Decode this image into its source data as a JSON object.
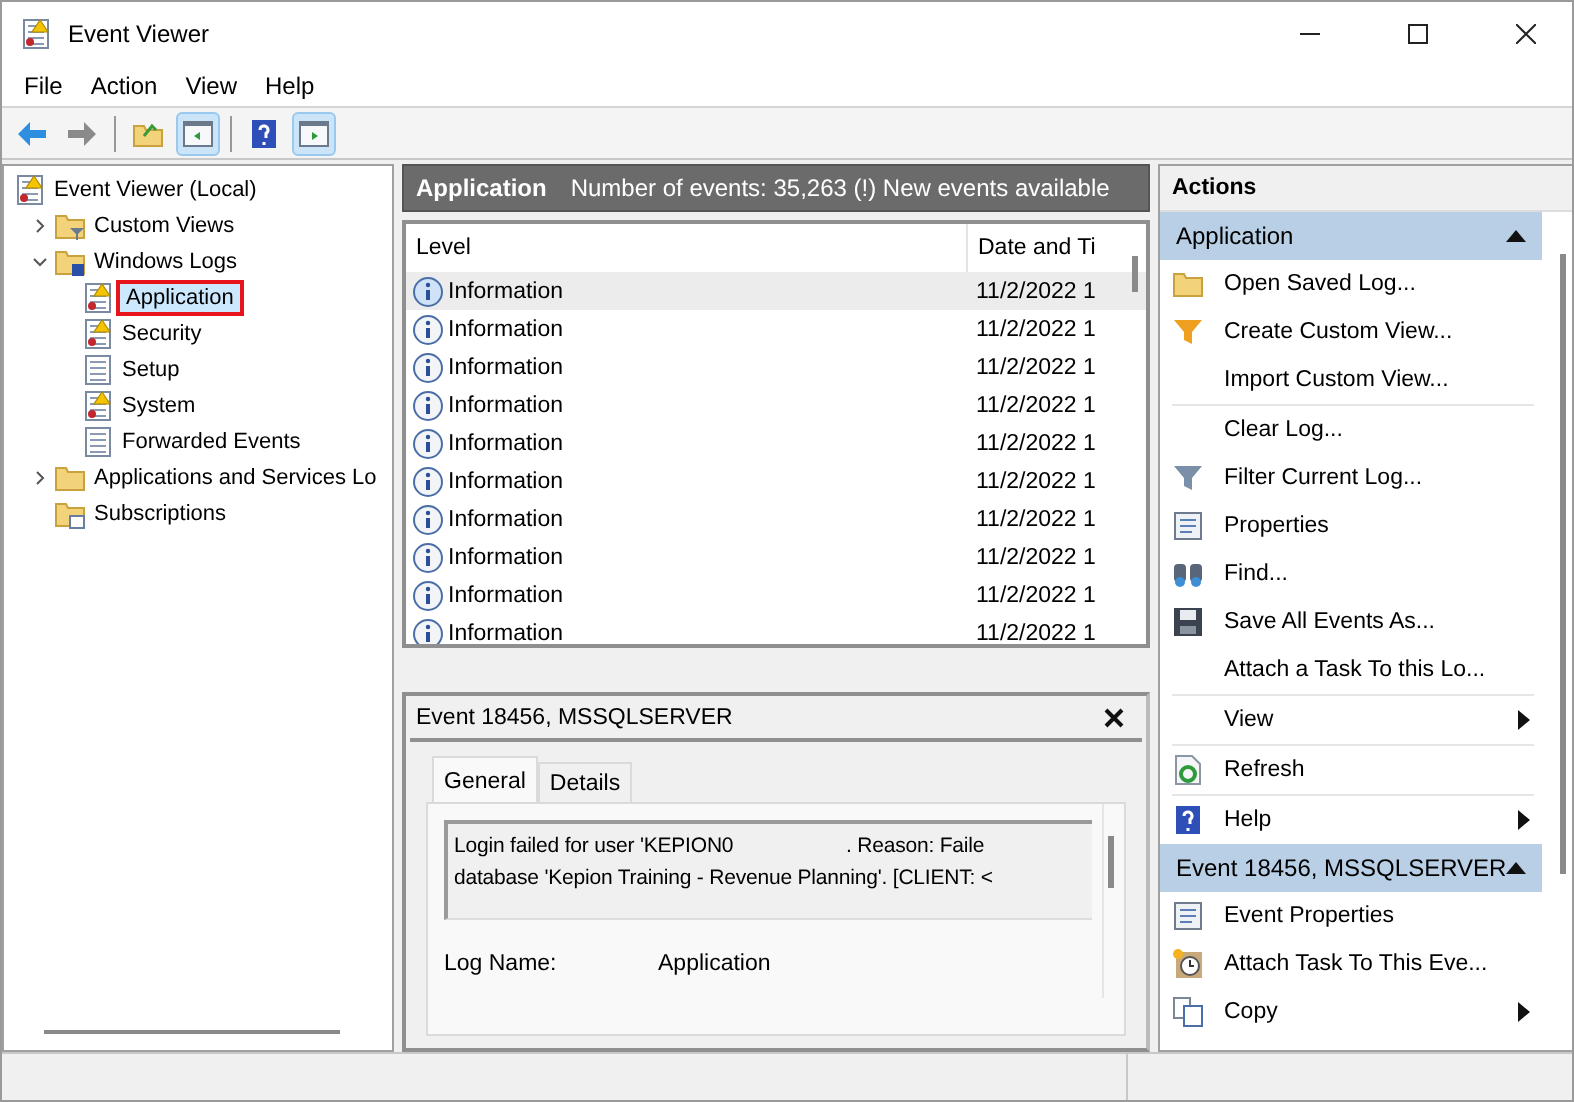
{
  "window": {
    "title": "Event Viewer"
  },
  "menu": [
    "File",
    "Action",
    "View",
    "Help"
  ],
  "toolbar": [
    {
      "pressed": false
    },
    {
      "pressed": false
    },
    {
      "pressed": false
    },
    {
      "pressed": true
    },
    {
      "pressed": false
    },
    {
      "pressed": true
    }
  ],
  "tree": [
    {
      "label": "Event Viewer (Local)",
      "kind": "root",
      "selected": false,
      "children": [
        {
          "label": "Custom Views",
          "kind": "filter-folder",
          "expanded": false,
          "selected": false
        },
        {
          "label": "Windows Logs",
          "kind": "logs-folder",
          "expanded": true,
          "selected": false,
          "children": [
            {
              "label": "Application",
              "kind": "log-warn",
              "selected": true
            },
            {
              "label": "Security",
              "kind": "log-warn",
              "selected": false
            },
            {
              "label": "Setup",
              "kind": "log",
              "selected": false
            },
            {
              "label": "System",
              "kind": "log-warn",
              "selected": false
            },
            {
              "label": "Forwarded Events",
              "kind": "log",
              "selected": false
            }
          ]
        },
        {
          "label": "Applications and Services Lo",
          "kind": "folder",
          "expanded": false,
          "selected": false
        },
        {
          "label": "Subscriptions",
          "kind": "subs-folder",
          "selected": false
        }
      ]
    }
  ],
  "center": {
    "title": "Application",
    "summary": "Number of events: 35,263 (!) New events available",
    "columns": [
      "Level",
      "Date and Ti"
    ],
    "rows": [
      {
        "level": "Information",
        "date": "11/2/2022 1",
        "selected": true
      },
      {
        "level": "Information",
        "date": "11/2/2022 1",
        "selected": false
      },
      {
        "level": "Information",
        "date": "11/2/2022 1",
        "selected": false
      },
      {
        "level": "Information",
        "date": "11/2/2022 1",
        "selected": false
      },
      {
        "level": "Information",
        "date": "11/2/2022 1",
        "selected": false
      },
      {
        "level": "Information",
        "date": "11/2/2022 1",
        "selected": false
      },
      {
        "level": "Information",
        "date": "11/2/2022 1",
        "selected": false
      },
      {
        "level": "Information",
        "date": "11/2/2022 1",
        "selected": false
      },
      {
        "level": "Information",
        "date": "11/2/2022 1",
        "selected": false
      },
      {
        "level": "Information",
        "date": "11/2/2022 1",
        "selected": false
      }
    ]
  },
  "detail": {
    "title": "Event 18456, MSSQLSERVER",
    "tabs": [
      {
        "label": "General",
        "selected": true
      },
      {
        "label": "Details",
        "selected": false
      }
    ],
    "message": [
      "Login failed for user 'KEPION0                    . Reason: Faile",
      "database 'Kepion Training - Revenue Planning'. [CLIENT: <"
    ],
    "fields": [
      {
        "label": "Log Name:",
        "value": "Application"
      }
    ]
  },
  "actions": {
    "title": "Actions",
    "sections": [
      {
        "title": "Application",
        "items": [
          {
            "label": "Open Saved Log...",
            "kind": "open",
            "divider": false,
            "submenu": false
          },
          {
            "label": "Create Custom View...",
            "kind": "filter-new",
            "divider": false,
            "submenu": false
          },
          {
            "label": "Import Custom View...",
            "kind": "none",
            "divider": false,
            "submenu": false
          },
          {
            "label": "Clear Log...",
            "kind": "none",
            "divider": true,
            "submenu": false
          },
          {
            "label": "Filter Current Log...",
            "kind": "filter",
            "divider": false,
            "submenu": false
          },
          {
            "label": "Properties",
            "kind": "props",
            "divider": false,
            "submenu": false
          },
          {
            "label": "Find...",
            "kind": "find",
            "divider": false,
            "submenu": false
          },
          {
            "label": "Save All Events As...",
            "kind": "save",
            "divider": false,
            "submenu": false
          },
          {
            "label": "Attach a Task To this Lo...",
            "kind": "none",
            "divider": false,
            "submenu": false
          },
          {
            "label": "View",
            "kind": "none",
            "divider": true,
            "submenu": true
          },
          {
            "label": "Refresh",
            "kind": "refresh",
            "divider": true,
            "submenu": false
          },
          {
            "label": "Help",
            "kind": "help",
            "divider": true,
            "submenu": true
          }
        ]
      },
      {
        "title": "Event 18456, MSSQLSERVER",
        "items": [
          {
            "label": "Event Properties",
            "kind": "props",
            "divider": false,
            "submenu": false
          },
          {
            "label": "Attach Task To This Eve...",
            "kind": "task",
            "divider": false,
            "submenu": false
          },
          {
            "label": "Copy",
            "kind": "copy",
            "divider": false,
            "submenu": true
          }
        ]
      }
    ]
  }
}
